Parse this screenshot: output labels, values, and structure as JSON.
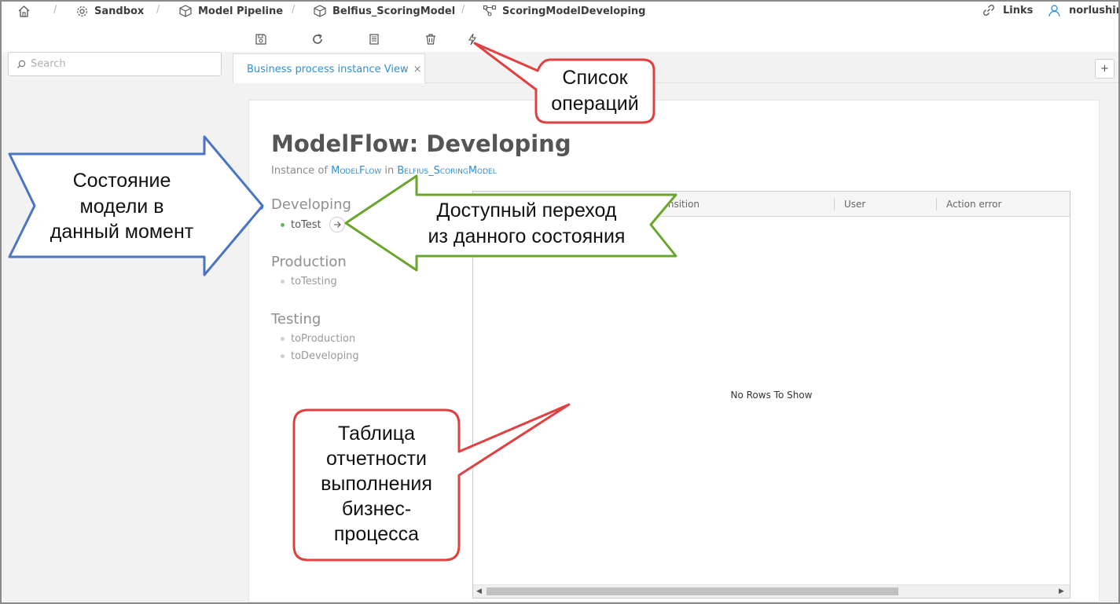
{
  "breadcrumb": {
    "items": [
      {
        "label": "Sandbox",
        "icon": "gear-icon"
      },
      {
        "label": "Model Pipeline",
        "icon": "cube-icon"
      },
      {
        "label": "Belfius_ScoringModel",
        "icon": "cube-icon"
      },
      {
        "label": "ScoringModelDeveloping",
        "icon": "flow-icon"
      }
    ],
    "separator": "/"
  },
  "header": {
    "links_label": "Links",
    "user_name": "norlushin"
  },
  "sidebar": {
    "search_placeholder": "Search"
  },
  "tabs": [
    {
      "label": "Business process instance View",
      "close": "×"
    }
  ],
  "add_tab": "+",
  "main": {
    "title": "ModelFlow: Developing",
    "subtitle_prefix": "Instance of",
    "subtitle_link1": "ModelFlow",
    "subtitle_mid": "in",
    "subtitle_link2": "Belfius_ScoringModel",
    "states": [
      {
        "name": "Developing",
        "transitions": [
          "toTest"
        ]
      },
      {
        "name": "Production",
        "transitions": [
          "toTesting"
        ]
      },
      {
        "name": "Testing",
        "transitions": [
          "toProduction",
          "toDeveloping"
        ]
      }
    ]
  },
  "grid": {
    "columns": [
      "Transition",
      "User",
      "Action error"
    ],
    "empty_text": "No Rows To Show"
  },
  "annotations": {
    "operations_list": "Список\nопераций",
    "current_state": "Состояние\nмодели в\nданный момент",
    "available_transition": "Доступный переход\nиз данного состояния",
    "report_table": "Таблица\nотчетности\nвыполнения\nбизнес-\nпроцесса"
  },
  "colors": {
    "link_blue": "#2b90d9",
    "active_green": "#5cb85c",
    "callout_red": "#e04040",
    "arrow_blue": "#4a74c4",
    "arrow_green": "#6aa62e"
  }
}
